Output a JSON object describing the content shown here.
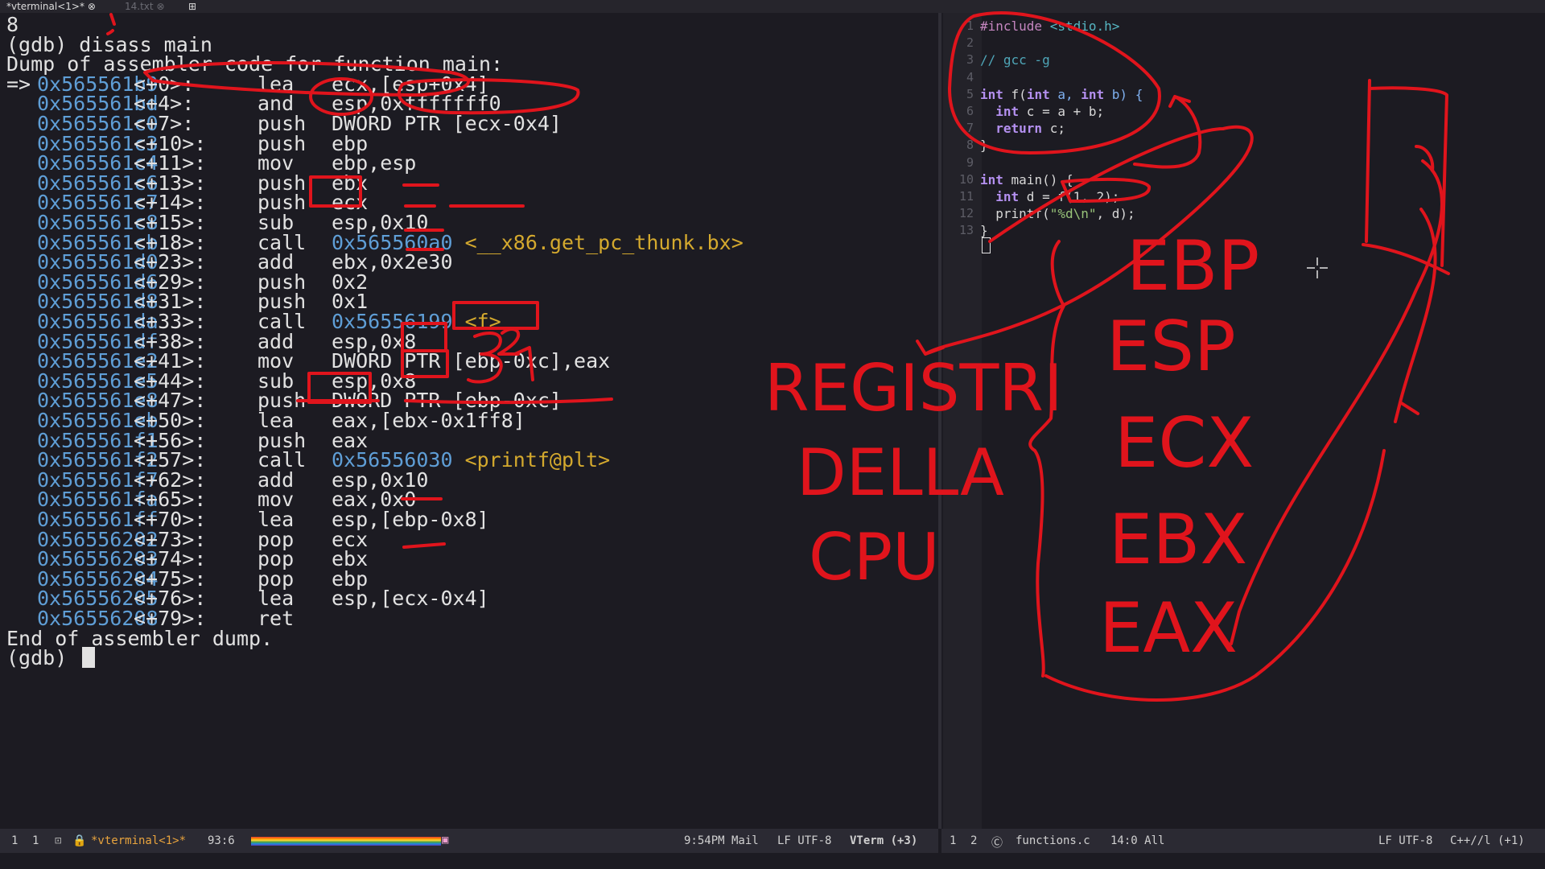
{
  "tabs": [
    {
      "label": "*vterminal<1>*",
      "icon": "close-icon"
    },
    {
      "label": "14.txt",
      "icon": "close-icon"
    }
  ],
  "terminal": {
    "pre_line": "8",
    "command": "(gdb) disass main",
    "header": "Dump of assembler code for function main:",
    "instructions": [
      {
        "marker": "=>",
        "addr": "0x565561b9",
        "off": "<+0>:",
        "op": "lea",
        "args": "ecx,[esp+0x4]"
      },
      {
        "marker": "",
        "addr": "0x565561bd",
        "off": "<+4>:",
        "op": "and",
        "args": "esp,0xfffffff0"
      },
      {
        "marker": "",
        "addr": "0x565561c0",
        "off": "<+7>:",
        "op": "push",
        "args": "DWORD PTR [ecx-0x4]"
      },
      {
        "marker": "",
        "addr": "0x565561c3",
        "off": "<+10>:",
        "op": "push",
        "args": "ebp"
      },
      {
        "marker": "",
        "addr": "0x565561c4",
        "off": "<+11>:",
        "op": "mov",
        "args": "ebp,esp"
      },
      {
        "marker": "",
        "addr": "0x565561c6",
        "off": "<+13>:",
        "op": "push",
        "args": "ebx"
      },
      {
        "marker": "",
        "addr": "0x565561c7",
        "off": "<+14>:",
        "op": "push",
        "args": "ecx"
      },
      {
        "marker": "",
        "addr": "0x565561c8",
        "off": "<+15>:",
        "op": "sub",
        "args": "esp,0x10"
      },
      {
        "marker": "",
        "addr": "0x565561cb",
        "off": "<+18>:",
        "op": "call",
        "args": "",
        "target": "0x565560a0",
        "sym": "<__x86.get_pc_thunk.bx>"
      },
      {
        "marker": "",
        "addr": "0x565561d0",
        "off": "<+23>:",
        "op": "add",
        "args": "ebx,0x2e30"
      },
      {
        "marker": "",
        "addr": "0x565561d6",
        "off": "<+29>:",
        "op": "push",
        "args": "0x2"
      },
      {
        "marker": "",
        "addr": "0x565561d8",
        "off": "<+31>:",
        "op": "push",
        "args": "0x1"
      },
      {
        "marker": "",
        "addr": "0x565561da",
        "off": "<+33>:",
        "op": "call",
        "args": "",
        "target": "0x56556199",
        "sym": "<f>"
      },
      {
        "marker": "",
        "addr": "0x565561df",
        "off": "<+38>:",
        "op": "add",
        "args": "esp,0x8"
      },
      {
        "marker": "",
        "addr": "0x565561e2",
        "off": "<+41>:",
        "op": "mov",
        "args": "DWORD PTR [ebp-0xc],eax"
      },
      {
        "marker": "",
        "addr": "0x565561e5",
        "off": "<+44>:",
        "op": "sub",
        "args": "esp,0x8"
      },
      {
        "marker": "",
        "addr": "0x565561e8",
        "off": "<+47>:",
        "op": "push",
        "args": "DWORD PTR [ebp-0xc]"
      },
      {
        "marker": "",
        "addr": "0x565561eb",
        "off": "<+50>:",
        "op": "lea",
        "args": "eax,[ebx-0x1ff8]"
      },
      {
        "marker": "",
        "addr": "0x565561f1",
        "off": "<+56>:",
        "op": "push",
        "args": "eax"
      },
      {
        "marker": "",
        "addr": "0x565561f2",
        "off": "<+57>:",
        "op": "call",
        "args": "",
        "target": "0x56556030",
        "sym": "<printf@plt>"
      },
      {
        "marker": "",
        "addr": "0x565561f7",
        "off": "<+62>:",
        "op": "add",
        "args": "esp,0x10"
      },
      {
        "marker": "",
        "addr": "0x565561fa",
        "off": "<+65>:",
        "op": "mov",
        "args": "eax,0x0"
      },
      {
        "marker": "",
        "addr": "0x565561ff",
        "off": "<+70>:",
        "op": "lea",
        "args": "esp,[ebp-0x8]"
      },
      {
        "marker": "",
        "addr": "0x56556202",
        "off": "<+73>:",
        "op": "pop",
        "args": "ecx"
      },
      {
        "marker": "",
        "addr": "0x56556203",
        "off": "<+74>:",
        "op": "pop",
        "args": "ebx"
      },
      {
        "marker": "",
        "addr": "0x56556204",
        "off": "<+75>:",
        "op": "pop",
        "args": "ebp"
      },
      {
        "marker": "",
        "addr": "0x56556205",
        "off": "<+76>:",
        "op": "lea",
        "args": "esp,[ecx-0x4]"
      },
      {
        "marker": "",
        "addr": "0x56556208",
        "off": "<+79>:",
        "op": "ret",
        "args": ""
      }
    ],
    "footer": "End of assembler dump.",
    "prompt": "(gdb)"
  },
  "editor": {
    "line_numbers": [
      "1",
      "2",
      "3",
      "4",
      "5",
      "6",
      "7",
      "8",
      "9",
      "10",
      "11",
      "12",
      "13"
    ],
    "lines": [
      [
        {
          "t": "#include ",
          "c": "pp"
        },
        {
          "t": "<stdio.h>",
          "c": "inc"
        }
      ],
      [],
      [
        {
          "t": "// gcc -g",
          "c": "cm"
        }
      ],
      [],
      [
        {
          "t": "int",
          "c": "kw"
        },
        {
          "t": " f(",
          "c": ""
        },
        {
          "t": "int",
          "c": "kw"
        },
        {
          "t": " a, ",
          "c": "par"
        },
        {
          "t": "int",
          "c": "kw"
        },
        {
          "t": " b) {",
          "c": "par"
        }
      ],
      [
        {
          "t": "  ",
          "c": ""
        },
        {
          "t": "int",
          "c": "kw"
        },
        {
          "t": " c = a + b;",
          "c": ""
        }
      ],
      [
        {
          "t": "  ",
          "c": ""
        },
        {
          "t": "return",
          "c": "kw"
        },
        {
          "t": " c;",
          "c": ""
        }
      ],
      [
        {
          "t": "}",
          "c": ""
        }
      ],
      [],
      [
        {
          "t": "int",
          "c": "kw"
        },
        {
          "t": " main() {",
          "c": ""
        }
      ],
      [
        {
          "t": "  ",
          "c": ""
        },
        {
          "t": "int",
          "c": "kw"
        },
        {
          "t": " d = f(1, 2);",
          "c": ""
        }
      ],
      [
        {
          "t": "  printf(",
          "c": ""
        },
        {
          "t": "\"%d\\n\"",
          "c": "str"
        },
        {
          "t": ", d);",
          "c": ""
        }
      ],
      [
        {
          "t": "}",
          "c": ""
        }
      ]
    ]
  },
  "modeline_left": {
    "win": "1",
    "num": "1",
    "buffer": "*vterminal<1>*",
    "pos": "93:6",
    "time_mail": "9:54PM Mail",
    "encoding": "LF UTF-8",
    "mode": "VTerm (+3)"
  },
  "modeline_right": {
    "win": "1",
    "num": "2",
    "buffer": "functions.c",
    "pos": "14:0 All",
    "encoding": "LF UTF-8",
    "mode": "C++//l (+1)"
  },
  "annotations": {
    "registers_label": [
      "REGISTRI",
      "DELLA",
      "CPU"
    ],
    "registers": [
      "EBP",
      "ESP",
      "ECX",
      "EBX",
      "EAX"
    ],
    "stack_numbers": [
      "3",
      "2",
      "1"
    ],
    "ink_color": "#e0141c"
  },
  "colors": {
    "background": "#1c1b22",
    "address": "#5f9ed6",
    "symbol": "#d4a92e",
    "text": "#e2e2e2"
  }
}
